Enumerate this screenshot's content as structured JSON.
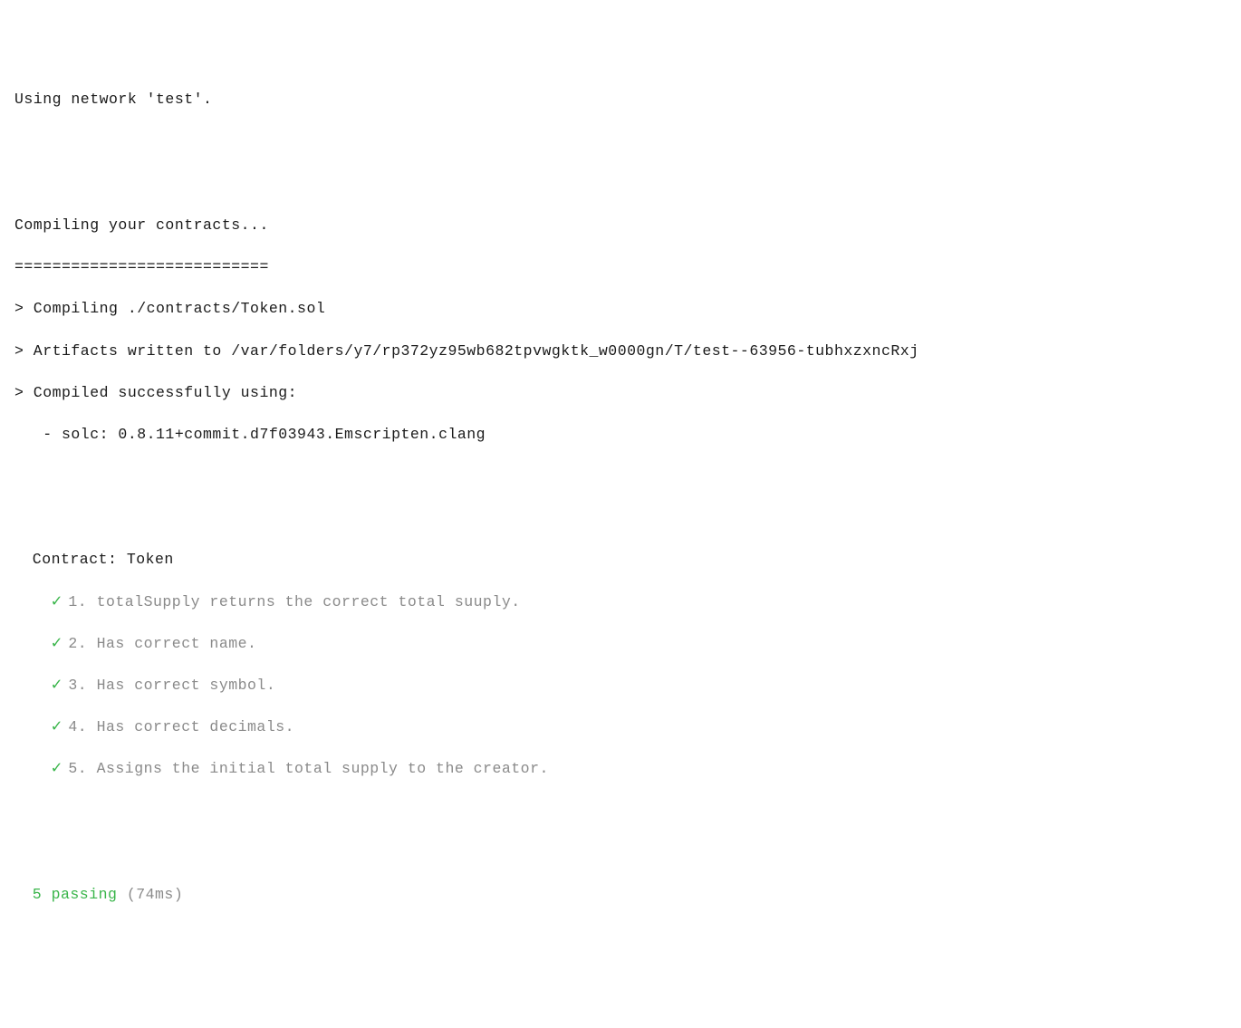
{
  "header": {
    "network_line": "Using network 'test'."
  },
  "compile": {
    "title": "Compiling your contracts...",
    "divider": "===========================",
    "lines": [
      "> Compiling ./contracts/Token.sol",
      "> Artifacts written to /var/folders/y7/rp372yz95wb682tpvwgktk_w0000gn/T/test--63956-tubhxzxncRxj",
      "> Compiled successfully using:"
    ],
    "solc_line": "   - solc: 0.8.11+commit.d7f03943.Emscripten.clang"
  },
  "tests": {
    "contract_label": "Contract: Token",
    "check_glyph": "✓",
    "items": [
      {
        "text": "1. totalSupply returns the correct total suuply."
      },
      {
        "text": "2. Has correct name."
      },
      {
        "text": "3. Has correct symbol."
      },
      {
        "text": "4. Has correct decimals."
      },
      {
        "text": "5. Assigns the initial total supply to the creator."
      }
    ]
  },
  "summary": {
    "passing": "5 passing",
    "time": " (74ms)"
  }
}
